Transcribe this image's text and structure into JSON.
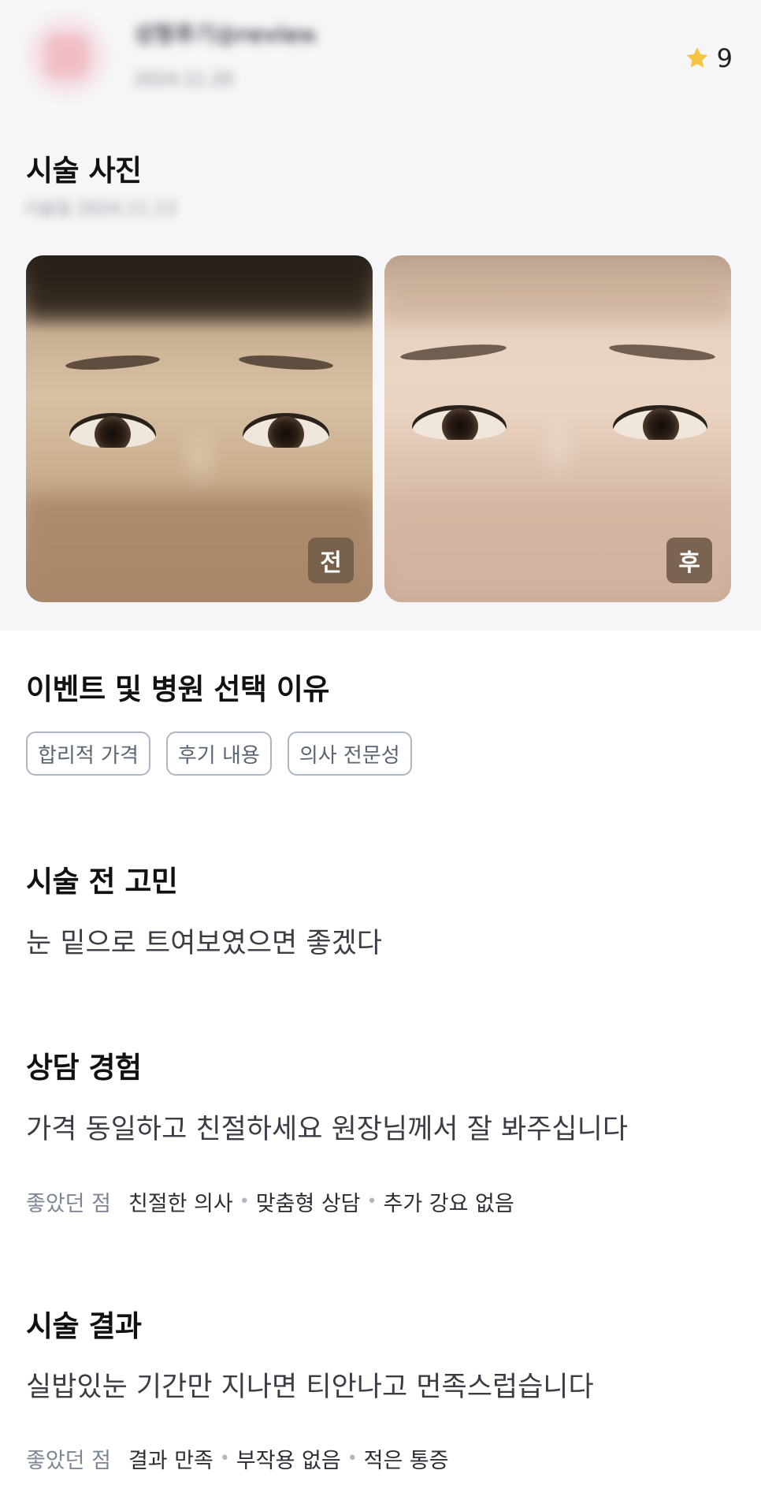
{
  "header": {
    "username": "성형후기@review",
    "date": "2024.11.20",
    "rating_value": "9"
  },
  "photos": {
    "title": "시술 사진",
    "date": "시술일 2024.11.13",
    "before_label": "전",
    "after_label": "후"
  },
  "reasons": {
    "title": "이벤트 및 병원 선택 이유",
    "tags": [
      "합리적 가격",
      "후기 내용",
      "의사 전문성"
    ]
  },
  "concern": {
    "title": "시술 전 고민",
    "text": "눈 밑으로 트여보였으면 좋겠다"
  },
  "consultation": {
    "title": "상담 경험",
    "text": "가격 동일하고 친절하세요 원장님께서 잘 봐주십니다",
    "likes_label": "좋았던 점",
    "likes": [
      "친절한 의사",
      "맞춤형 상담",
      "추가 강요 없음"
    ]
  },
  "result": {
    "title": "시술 결과",
    "text": "실밥있눈 기간만 지나면 티안나고 먼족스럽습니다",
    "likes_label": "좋았던 점",
    "likes": [
      "결과 만족",
      "부작용 없음",
      "적은 통증"
    ]
  },
  "colors": {
    "star": "#F5C542",
    "chip_border": "#AEB6C0",
    "badge": "#735C4A"
  }
}
